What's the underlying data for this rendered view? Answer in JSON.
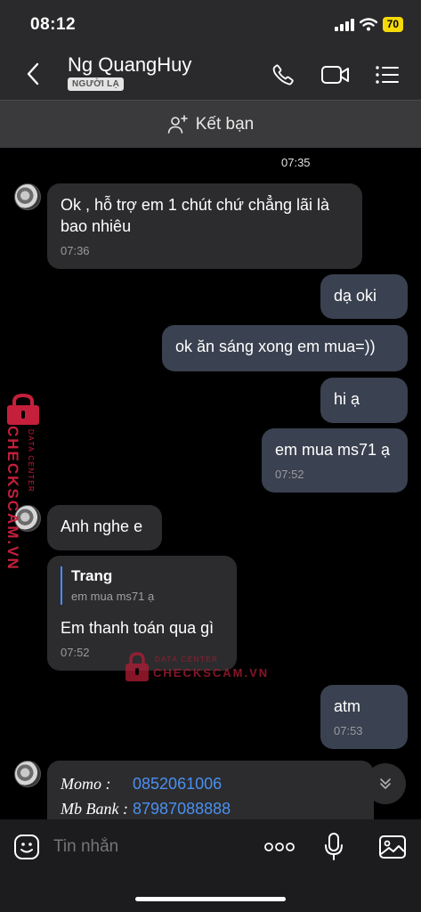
{
  "status_bar": {
    "time": "08:12",
    "battery": "70"
  },
  "header": {
    "contact_name": "Ng QuangHuy",
    "stranger_badge": "NGƯỜI LẠ"
  },
  "friend_bar": {
    "label": "Kết bạn"
  },
  "chat": {
    "time_separator": "07:35",
    "messages": [
      {
        "dir": "in",
        "text": "Ok , hỗ trợ em 1 chút chứ chẳng lãi là bao nhiêu",
        "time": "07:36"
      },
      {
        "dir": "out",
        "text": "dạ oki"
      },
      {
        "dir": "out",
        "text": "ok ăn sáng xong em mua=))"
      },
      {
        "dir": "out",
        "text": "hi ạ"
      },
      {
        "dir": "out",
        "text": "em mua ms71 ạ",
        "time": "07:52"
      },
      {
        "dir": "in",
        "text": "Anh nghe e"
      },
      {
        "dir": "in",
        "quote_name": "Trang",
        "quote_text": "em mua ms71 ạ",
        "text": "Em thanh toán qua gì",
        "time": "07:52"
      },
      {
        "dir": "out",
        "text": "atm",
        "time": "07:53"
      },
      {
        "dir": "in",
        "payment": [
          {
            "label": "Momo :",
            "value": "0852061006"
          },
          {
            "label": "Mb Bank :",
            "value": "87987088888"
          }
        ]
      }
    ]
  },
  "watermark": {
    "brand": "CHECKSCAM.VN",
    "tagline": "DATA CENTER"
  },
  "input_bar": {
    "placeholder": "Tin nhắn"
  },
  "colors": {
    "accent_link": "#4a90f0",
    "outgoing_bubble": "#3a4150",
    "incoming_bubble": "#2c2c2e",
    "battery": "#f5d90a"
  },
  "icons": [
    "back-icon",
    "phone-icon",
    "video-call-icon",
    "menu-icon",
    "add-friend-icon",
    "sticker-icon",
    "more-icon",
    "microphone-icon",
    "image-icon",
    "chevron-down-icon"
  ]
}
